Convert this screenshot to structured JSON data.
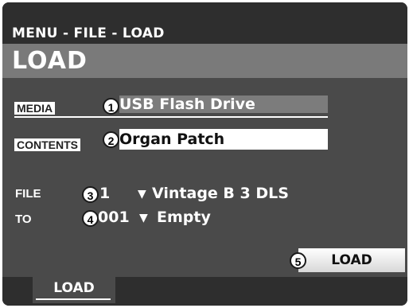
{
  "breadcrumb": "MENU - FILE - LOAD",
  "page_title": "LOAD",
  "media": {
    "label": "MEDIA",
    "value": "USB Flash Drive",
    "badge": "1"
  },
  "contents": {
    "label": "CONTENTS",
    "value": "Organ Patch",
    "badge": "2"
  },
  "file": {
    "label": "FILE",
    "number": "1",
    "arrow": "▼",
    "name": "Vintage B 3 DLS",
    "badge": "3"
  },
  "to": {
    "label": "TO",
    "number": "001",
    "arrow": "▼",
    "name": "Empty",
    "badge": "4"
  },
  "load_button": {
    "label": "LOAD",
    "badge": "5"
  },
  "bottom_tab": {
    "label": "LOAD"
  }
}
